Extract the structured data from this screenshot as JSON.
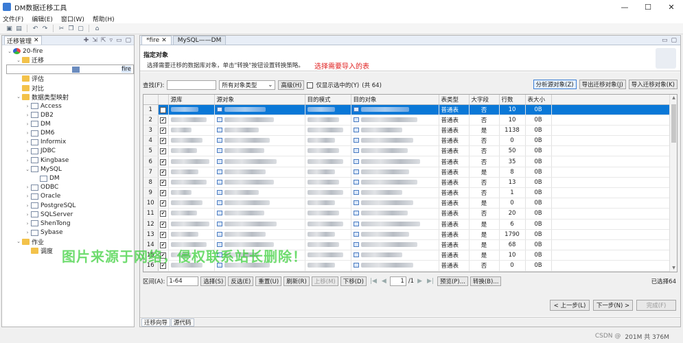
{
  "window": {
    "title": "DM数据迁移工具",
    "controls": [
      "—",
      "☐",
      "✕"
    ]
  },
  "menu": [
    "文件(F)",
    "编辑(E)",
    "窗口(W)",
    "帮助(H)"
  ],
  "left_panel": {
    "tab_label": "迁移管理",
    "tree": [
      {
        "label": "20-fire",
        "level": 0,
        "icon": "root",
        "exp": "v"
      },
      {
        "label": "迁移",
        "level": 1,
        "icon": "folder",
        "exp": "v"
      },
      {
        "label": "fire",
        "level": 2,
        "icon": "fire",
        "exp": "",
        "selected": true
      },
      {
        "label": "评估",
        "level": 1,
        "icon": "folder",
        "exp": ""
      },
      {
        "label": "对比",
        "level": 1,
        "icon": "folder",
        "exp": ""
      },
      {
        "label": "数据类型映射",
        "level": 1,
        "icon": "folder",
        "exp": "v"
      },
      {
        "label": "Access",
        "level": 2,
        "icon": "db",
        "exp": ">"
      },
      {
        "label": "DB2",
        "level": 2,
        "icon": "db",
        "exp": ">"
      },
      {
        "label": "DM",
        "level": 2,
        "icon": "db",
        "exp": ">"
      },
      {
        "label": "DM6",
        "level": 2,
        "icon": "db",
        "exp": ">"
      },
      {
        "label": "Informix",
        "level": 2,
        "icon": "db",
        "exp": ">"
      },
      {
        "label": "JDBC",
        "level": 2,
        "icon": "db",
        "exp": ">"
      },
      {
        "label": "Kingbase",
        "level": 2,
        "icon": "db",
        "exp": ">"
      },
      {
        "label": "MySQL",
        "level": 2,
        "icon": "db",
        "exp": "v"
      },
      {
        "label": "DM",
        "level": 3,
        "icon": "db",
        "exp": ""
      },
      {
        "label": "ODBC",
        "level": 2,
        "icon": "db",
        "exp": ">"
      },
      {
        "label": "Oracle",
        "level": 2,
        "icon": "db",
        "exp": ">"
      },
      {
        "label": "PostgreSQL",
        "level": 2,
        "icon": "db",
        "exp": ">"
      },
      {
        "label": "SQLServer",
        "level": 2,
        "icon": "db",
        "exp": ">"
      },
      {
        "label": "ShenTong",
        "level": 2,
        "icon": "db",
        "exp": ">"
      },
      {
        "label": "Sybase",
        "level": 2,
        "icon": "db",
        "exp": ">"
      },
      {
        "label": "作业",
        "level": 1,
        "icon": "folder",
        "exp": "v"
      },
      {
        "label": "调度",
        "level": 2,
        "icon": "folder",
        "exp": ""
      }
    ]
  },
  "main": {
    "tabs": [
      "*fire",
      "MySQL——DM"
    ],
    "header_title": "指定对象",
    "header_desc": "选择需要迁移的数据库对象，单击\"转换\"按钮设置转换策略。",
    "annotation": "选择需要导入的表",
    "search_label": "查找(F):",
    "search_value": "",
    "type_select": "所有对象类型",
    "advanced_btn": "高级(H)",
    "only_selected_label": "仅显示选中的(Y)",
    "total_label": "(共 64)",
    "analyze_btn": "分析源对象(Z)",
    "export_btn": "导出迁移对象(J)",
    "import_btn": "导入迁移对象(K)",
    "columns": [
      "源库",
      "源对象",
      "目的模式",
      "目的对象",
      "表类型",
      "大字段",
      "行数",
      "表大小"
    ],
    "rows": [
      {
        "n": "1",
        "type": "普通表",
        "lob": "否",
        "rows": "10",
        "size": "0B"
      },
      {
        "n": "2",
        "type": "普通表",
        "lob": "否",
        "rows": "10",
        "size": "0B"
      },
      {
        "n": "3",
        "type": "普通表",
        "lob": "是",
        "rows": "1138",
        "size": "0B"
      },
      {
        "n": "4",
        "type": "普通表",
        "lob": "否",
        "rows": "0",
        "size": "0B"
      },
      {
        "n": "5",
        "type": "普通表",
        "lob": "否",
        "rows": "50",
        "size": "0B"
      },
      {
        "n": "6",
        "type": "普通表",
        "lob": "否",
        "rows": "35",
        "size": "0B"
      },
      {
        "n": "7",
        "type": "普通表",
        "lob": "是",
        "rows": "8",
        "size": "0B"
      },
      {
        "n": "8",
        "type": "普通表",
        "lob": "否",
        "rows": "13",
        "size": "0B"
      },
      {
        "n": "9",
        "type": "普通表",
        "lob": "否",
        "rows": "1",
        "size": "0B"
      },
      {
        "n": "10",
        "type": "普通表",
        "lob": "是",
        "rows": "0",
        "size": "0B"
      },
      {
        "n": "11",
        "type": "普通表",
        "lob": "否",
        "rows": "20",
        "size": "0B"
      },
      {
        "n": "12",
        "type": "普通表",
        "lob": "是",
        "rows": "6",
        "size": "0B"
      },
      {
        "n": "13",
        "type": "普通表",
        "lob": "是",
        "rows": "1790",
        "size": "0B"
      },
      {
        "n": "14",
        "type": "普通表",
        "lob": "是",
        "rows": "68",
        "size": "0B"
      },
      {
        "n": "15",
        "type": "普通表",
        "lob": "是",
        "rows": "10",
        "size": "0B"
      },
      {
        "n": "16",
        "type": "普通表",
        "lob": "否",
        "rows": "0",
        "size": "0B"
      }
    ],
    "range_label": "区间(A):",
    "range_value": "1-64",
    "range_buttons": [
      "选择(S)",
      "反选(E)",
      "重置(U)",
      "刷新(R)",
      "上移(M)",
      "下移(D)"
    ],
    "page_value": "1",
    "page_total": "/1",
    "preview_btn": "预览(P)...",
    "convert_btn": "转换(B)...",
    "selected_count": "已选择64",
    "prev_btn": "< 上一步(L)",
    "next_btn": "下一步(N) >",
    "finish_btn": "完成(F)",
    "watermark": "图片来源于网络，侵权联系站长删除！",
    "bottom_tabs": [
      "迁移向导",
      "源代码"
    ]
  },
  "status": {
    "csdn": "CSDN @",
    "memory": "201M 共 376M"
  }
}
